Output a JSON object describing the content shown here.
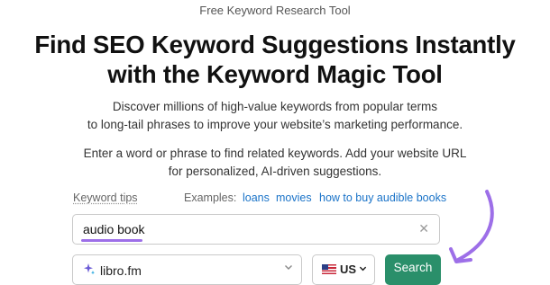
{
  "header": {
    "eyebrow": "Free Keyword Research Tool",
    "title_line1": "Find SEO Keyword Suggestions Instantly",
    "title_line2": "with the Keyword Magic Tool"
  },
  "intro": {
    "line1": "Discover millions of high-value keywords from popular terms",
    "line2": "to long-tail phrases to improve your website’s marketing performance."
  },
  "instructions": {
    "line1": "Enter a word or phrase to find related keywords. Add your website URL",
    "line2": "for personalized, AI-driven suggestions."
  },
  "tips": {
    "keyword_tips_label": "Keyword tips",
    "examples_label": "Examples:",
    "examples": [
      "loans",
      "movies",
      "how to buy audible books"
    ]
  },
  "search": {
    "value": "audio book",
    "clear_icon": "close-icon"
  },
  "domain": {
    "value": "libro.fm",
    "icon": "sparkle-icon"
  },
  "country": {
    "label": "US",
    "icon": "us-flag-icon"
  },
  "actions": {
    "search_label": "Search"
  },
  "colors": {
    "accent_purple": "#9d6fe8",
    "search_button": "#2a8f6a",
    "link": "#1a73c8"
  }
}
